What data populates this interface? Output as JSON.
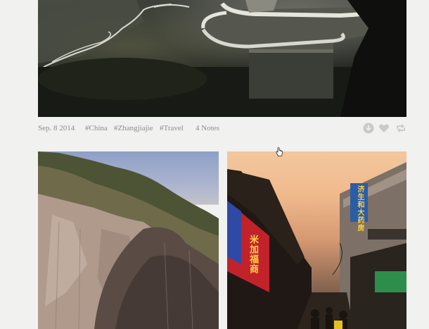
{
  "post": {
    "date": "Sep. 8 2014",
    "tags": [
      "#China",
      "#Zhangjiajie",
      "#Travel"
    ],
    "notes": "4 Notes"
  },
  "actions": {
    "download_icon": "download-icon",
    "like_icon": "heart-icon",
    "reblog_icon": "reblog-icon"
  },
  "photos": {
    "right": {
      "sign_pharmacy": "济生和大药房",
      "sign_shop": "米加福商"
    }
  }
}
